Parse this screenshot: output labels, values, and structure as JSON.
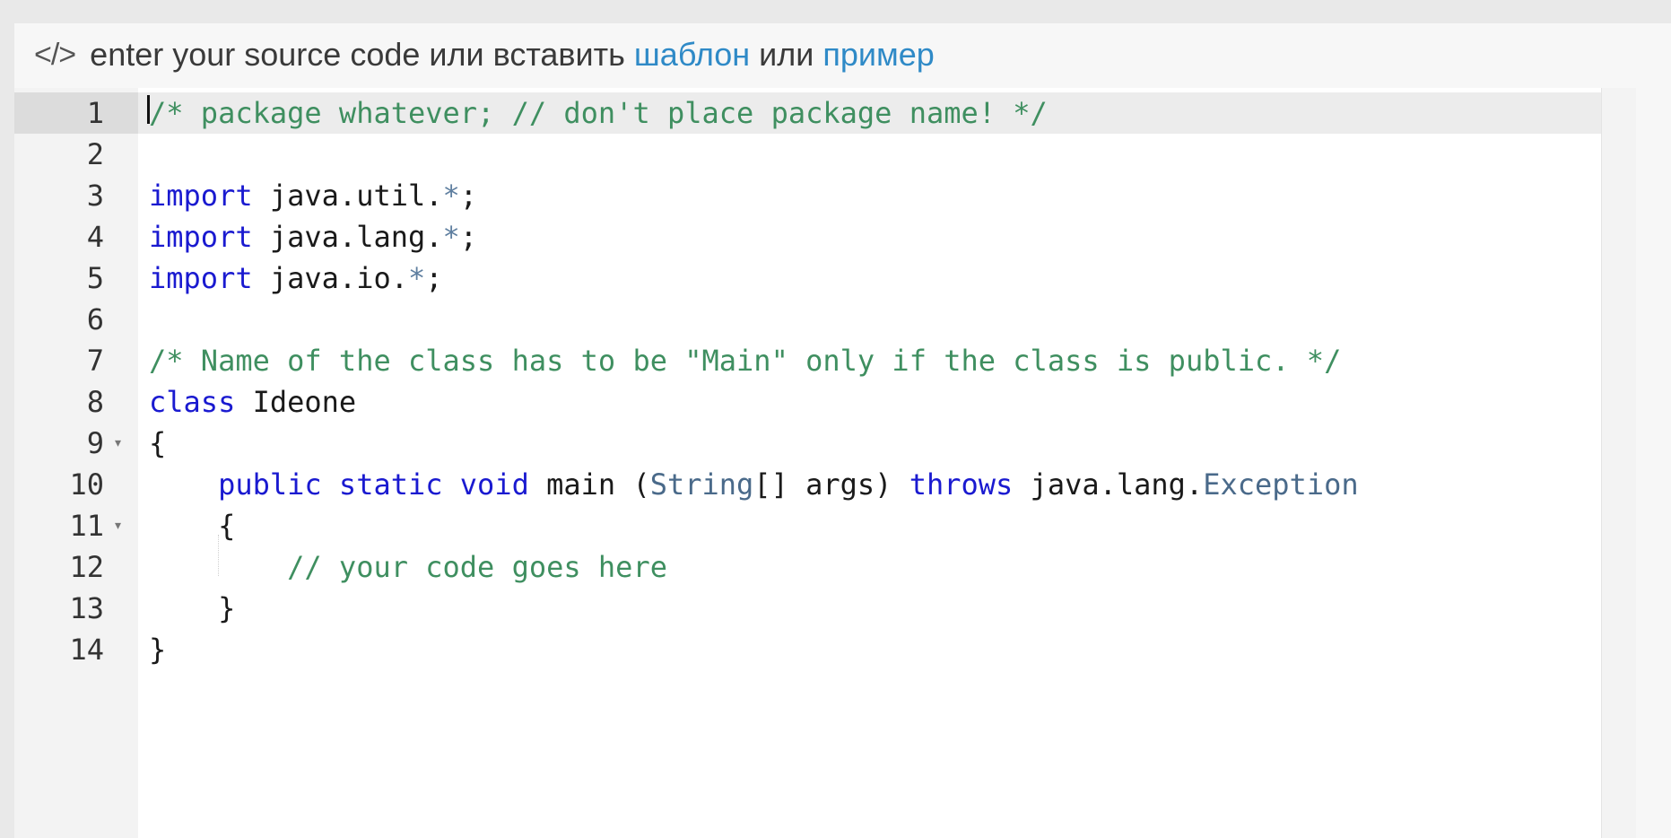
{
  "header": {
    "icon": "code-brackets-icon",
    "icon_glyph": "</>",
    "prefix": "enter your source code или вставить",
    "template_link": "шаблон",
    "or": "или",
    "example_link": "пример"
  },
  "editor": {
    "language": "java",
    "active_line": 1,
    "lines": [
      {
        "n": "1",
        "text": "/* package whatever; // don't place package name! */"
      },
      {
        "n": "2",
        "text": ""
      },
      {
        "n": "3",
        "text": "import java.util.*;"
      },
      {
        "n": "4",
        "text": "import java.lang.*;"
      },
      {
        "n": "5",
        "text": "import java.io.*;"
      },
      {
        "n": "6",
        "text": ""
      },
      {
        "n": "7",
        "text": "/* Name of the class has to be \"Main\" only if the class is public. */"
      },
      {
        "n": "8",
        "text": "class Ideone"
      },
      {
        "n": "9",
        "text": "{",
        "fold": true
      },
      {
        "n": "10",
        "text": "    public static void main (String[] args) throws java.lang.Exception"
      },
      {
        "n": "11",
        "text": "    {",
        "fold": true
      },
      {
        "n": "12",
        "text": "        // your code goes here"
      },
      {
        "n": "13",
        "text": "    }"
      },
      {
        "n": "14",
        "text": "}"
      }
    ]
  }
}
